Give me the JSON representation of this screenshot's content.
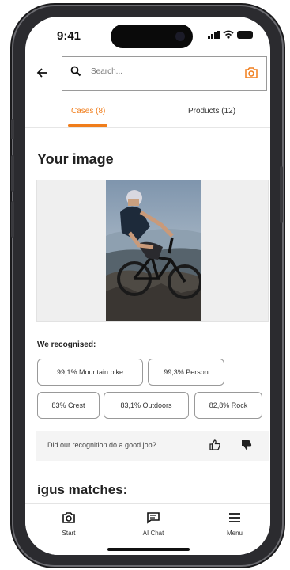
{
  "status_bar": {
    "time": "9:41"
  },
  "search": {
    "placeholder": "Search...",
    "value": ""
  },
  "tabs": [
    {
      "label": "Cases (8)",
      "active": true
    },
    {
      "label": "Products (12)",
      "active": false
    }
  ],
  "image_section": {
    "title": "Your image",
    "image_subject": "mountain biker riding on rocky mountain trail"
  },
  "recognition": {
    "label": "We recognised:",
    "chips": [
      "99,1% Mountain bike",
      "99,3% Person",
      "83% Crest",
      "83,1% Outdoors",
      "82,8% Rock"
    ]
  },
  "feedback": {
    "question": "Did our recognition do a good job?",
    "icons": [
      "thumbs-up-icon",
      "thumbs-down-icon"
    ]
  },
  "matches": {
    "title": "igus matches:"
  },
  "bottom_nav": [
    {
      "label": "Start",
      "icon": "camera-icon"
    },
    {
      "label": "AI Chat",
      "icon": "chat-icon"
    },
    {
      "label": "Menu",
      "icon": "menu-icon"
    }
  ],
  "colors": {
    "accent": "#f07d1b",
    "frame": "#2b2b2f"
  }
}
